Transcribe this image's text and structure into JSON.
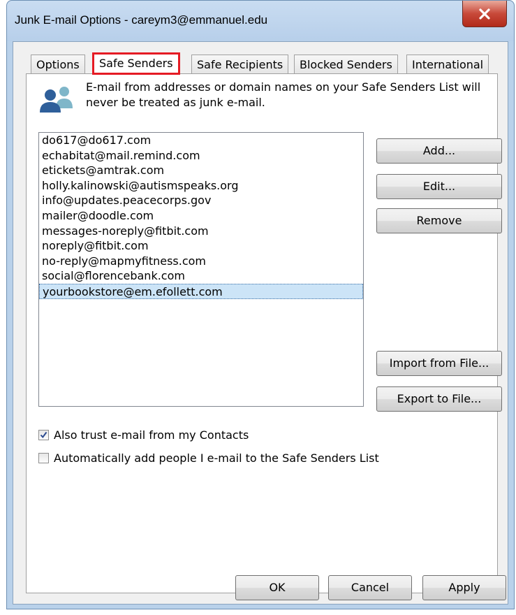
{
  "window": {
    "title": "Junk E-mail Options - careym3@emmanuel.edu",
    "close_icon": "close-x-icon"
  },
  "tabs": [
    {
      "label": "Options",
      "active": false
    },
    {
      "label": "Safe Senders",
      "active": true
    },
    {
      "label": "Safe Recipients",
      "active": false
    },
    {
      "label": "Blocked Senders",
      "active": false
    },
    {
      "label": "International",
      "active": false
    }
  ],
  "info": {
    "icon": "people-icon",
    "text": "E-mail from addresses or domain names on your Safe Senders List will never be treated as junk e-mail."
  },
  "senders": [
    "do617@do617.com",
    "echabitat@mail.remind.com",
    "etickets@amtrak.com",
    "holly.kalinowski@autismspeaks.org",
    "info@updates.peacecorps.gov",
    "mailer@doodle.com",
    "messages-noreply@fitbit.com",
    "noreply@fitbit.com",
    "no-reply@mapmyfitness.com",
    "social@florencebank.com",
    "yourbookstore@em.efollett.com"
  ],
  "selected_sender": "yourbookstore@em.efollett.com",
  "buttons": {
    "add": "Add...",
    "edit": "Edit...",
    "remove": "Remove",
    "import": "Import from File...",
    "export": "Export to File..."
  },
  "options": {
    "trust_contacts": {
      "label": "Also trust e-mail from my Contacts",
      "checked": true
    },
    "auto_add": {
      "label": "Automatically add people I e-mail to the Safe Senders List",
      "checked": false
    }
  },
  "footer": {
    "ok": "OK",
    "cancel": "Cancel",
    "apply": "Apply"
  },
  "colors": {
    "tab_highlight": "#e51b24",
    "selection": "#cce4f7"
  }
}
